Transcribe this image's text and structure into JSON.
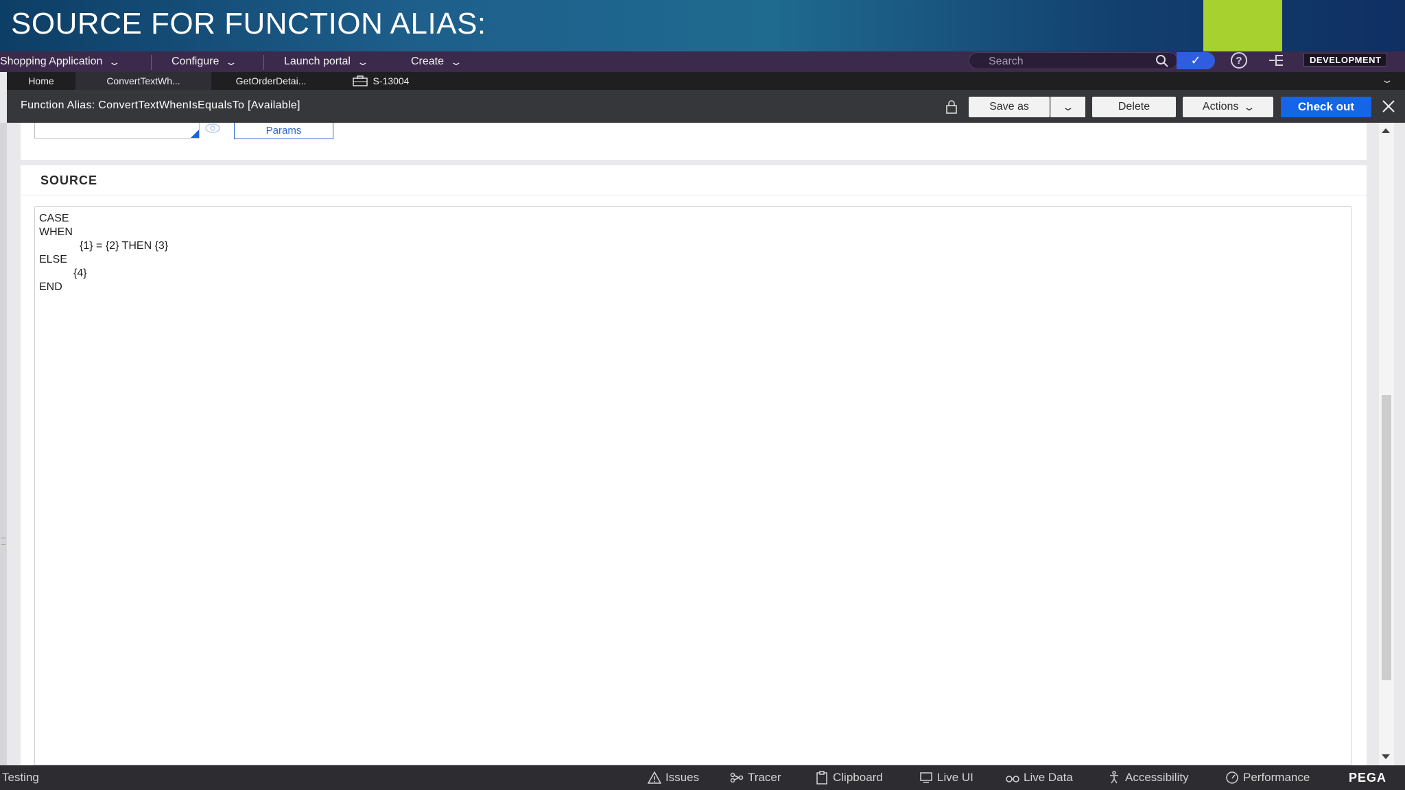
{
  "banner": {
    "title": "SOURCE FOR FUNCTION ALIAS:"
  },
  "topnav": {
    "items": [
      {
        "label": "Shopping Application"
      },
      {
        "label": "Configure"
      },
      {
        "label": "Launch portal"
      },
      {
        "label": "Create"
      }
    ],
    "search_placeholder": "Search",
    "environment": "DEVELOPMENT"
  },
  "tabs": [
    {
      "label": "Home"
    },
    {
      "label": "ConvertTextWh..."
    },
    {
      "label": "GetOrderDetai..."
    },
    {
      "label": "S-13004"
    }
  ],
  "rule_header": {
    "title": "Function Alias: ConvertTextWhenIsEqualsTo [Available]",
    "save_as": "Save as",
    "delete": "Delete",
    "actions": "Actions",
    "check_out": "Check out"
  },
  "form": {
    "params_label": "Params"
  },
  "source": {
    "heading": "SOURCE",
    "lines": [
      "CASE",
      "WHEN",
      "{1} = {2} THEN {3}",
      "ELSE",
      "{4}",
      "END"
    ]
  },
  "devbar": {
    "status": "Testing",
    "tools": [
      "Issues",
      "Tracer",
      "Clipboard",
      "Live UI",
      "Live Data",
      "Accessibility",
      "Performance"
    ],
    "brand": "PEGA"
  },
  "colors": {
    "nav_bg": "#3b2a4c",
    "primary": "#1565e6",
    "banner_accent": "#a6d12e"
  }
}
